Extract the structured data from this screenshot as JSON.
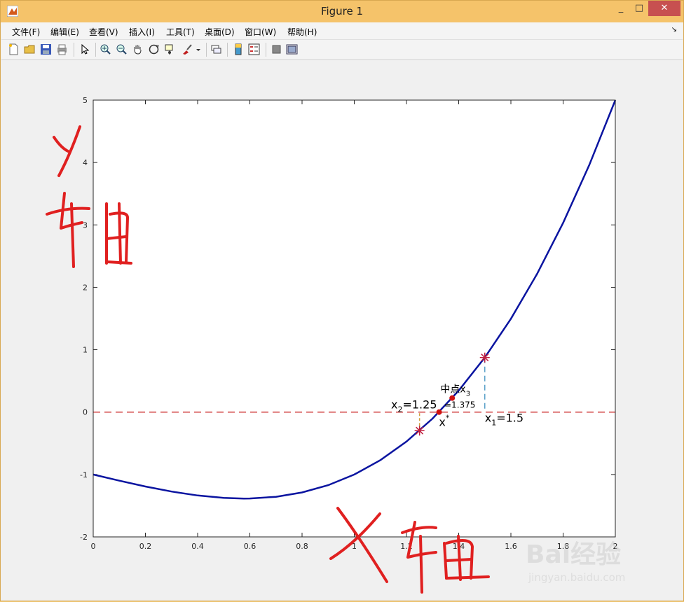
{
  "window": {
    "title": "Figure 1",
    "min_glyph": "_",
    "max_glyph": "□",
    "close_glyph": "✕"
  },
  "menu": {
    "items": [
      "文件(F)",
      "编辑(E)",
      "查看(V)",
      "插入(I)",
      "工具(T)",
      "桌面(D)",
      "窗口(W)",
      "帮助(H)"
    ],
    "overflow_glyph": "↘"
  },
  "toolbar": {
    "icons": [
      "new-figure-icon",
      "open-file-icon",
      "save-icon",
      "print-icon",
      "edit-plot-arrow-icon",
      "zoom-in-icon",
      "zoom-out-icon",
      "pan-hand-icon",
      "rotate-3d-icon",
      "data-cursor-icon",
      "brush-icon",
      "brush-dropdown-icon",
      "link-plot-icon",
      "colorbar-icon",
      "legend-icon",
      "hide-plot-tools-icon",
      "show-plot-tools-icon"
    ]
  },
  "chart_data": {
    "type": "line",
    "function_series": {
      "x": [
        0,
        0.1,
        0.2,
        0.3,
        0.4,
        0.5,
        0.577,
        0.6,
        0.7,
        0.8,
        0.9,
        1.0,
        1.1,
        1.2,
        1.3,
        1.4,
        1.5,
        1.6,
        1.7,
        1.8,
        1.9,
        2.0
      ],
      "y": [
        -1,
        -1.099,
        -1.192,
        -1.273,
        -1.336,
        -1.375,
        -1.385,
        -1.384,
        -1.357,
        -1.288,
        -1.171,
        -1.0,
        -0.769,
        -0.472,
        -0.103,
        0.344,
        0.875,
        1.496,
        2.213,
        3.032,
        3.959,
        5.0
      ],
      "color": "#0a14a0"
    },
    "zero_line": {
      "y": 0,
      "color": "#d04040"
    },
    "points": [
      {
        "x": 1.5,
        "y": 0.875,
        "marker": "star"
      },
      {
        "x": 1.25,
        "y": -0.297,
        "marker": "star"
      },
      {
        "x": 1.375,
        "y": 0.225,
        "marker": "dot"
      },
      {
        "x": 1.325,
        "y": 0,
        "marker": "dot"
      }
    ],
    "annotations": {
      "x1_label": "x",
      "x1_sub": "1",
      "x1_value": "=1.5",
      "x2_label": "x",
      "x2_sub": "2",
      "x2_value": "=1.25",
      "mid_label": "中点x",
      "mid_sub": "3",
      "x3_value": "=1.375",
      "root_label": "x",
      "root_sup": "*"
    },
    "xlim": [
      0,
      2
    ],
    "ylim": [
      -2,
      5
    ],
    "xticks": [
      "0",
      "0.2",
      "0.4",
      "0.6",
      "0.8",
      "1",
      "1.2",
      "1.4",
      "1.6",
      "1.8",
      "2"
    ],
    "yticks": [
      "-2",
      "-1",
      "0",
      "1",
      "2",
      "3",
      "4",
      "5"
    ],
    "xtick_values": [
      0,
      0.2,
      0.4,
      0.6,
      0.8,
      1.0,
      1.2,
      1.4,
      1.6,
      1.8,
      2.0
    ],
    "ytick_values": [
      -2,
      -1,
      0,
      1,
      2,
      3,
      4,
      5
    ],
    "grid": false
  },
  "handwriting": {
    "y_axis": "Y轴",
    "x_axis": "X轴",
    "color": "#e02020"
  },
  "watermark": {
    "brand": "Bai经验",
    "url": "jingyan.baidu.com"
  }
}
